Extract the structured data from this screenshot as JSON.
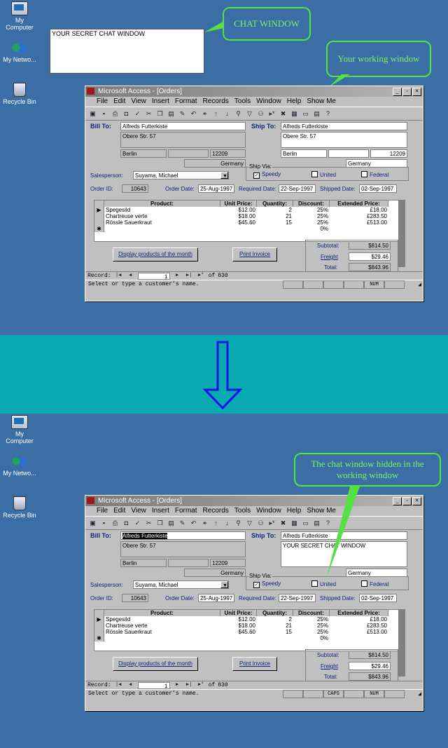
{
  "desktop": {
    "icons": [
      {
        "label": "My Computer"
      },
      {
        "label": "My Netwo..."
      },
      {
        "label": "Recycle Bin"
      }
    ]
  },
  "top": {
    "callout_chat": "CHAT WINDOW",
    "callout_work": "Your working window",
    "chat_text": "YOUR SECRET CHAT WINDOW"
  },
  "bottom": {
    "callout": "The chat window hidden in the working window"
  },
  "window": {
    "title": "Microsoft Access - [Orders]",
    "menu": [
      "File",
      "Edit",
      "View",
      "Insert",
      "Format",
      "Records",
      "Tools",
      "Window",
      "Help",
      "Show Me"
    ]
  },
  "form": {
    "bill_to_label": "Bill To:",
    "ship_to_label": "Ship To:",
    "bill_name": "Alfreds Futterkiste",
    "bill_address": "Obere Str. 57",
    "bill_city": "Berlin",
    "bill_postal": "12209",
    "bill_country": "Germany",
    "ship_name": "Alfreds Futterkiste",
    "ship_address": "Obere Str. 57",
    "ship_city": "Berlin",
    "ship_postal": "12209",
    "ship_country": "Germany",
    "salesperson_label": "Salesperson:",
    "salesperson": "Suyama, Michael",
    "ship_via_label": "Ship Via:",
    "ship_via": [
      "Speedy",
      "United",
      "Federal"
    ],
    "order_id_label": "Order ID:",
    "order_id": "10643",
    "order_date_label": "Order Date:",
    "order_date": "25-Aug-1997",
    "required_date_label": "Required Date:",
    "required_date": "22-Sep-1997",
    "shipped_date_label": "Shipped Date:",
    "shipped_date": "02-Sep-1997",
    "columns": [
      "Product:",
      "Unit Price:",
      "Quantity:",
      "Discount:",
      "Extended Price:"
    ],
    "rows": [
      [
        "Spegesild",
        "$12.00",
        "2",
        "25%",
        "£18.00"
      ],
      [
        "Chartreuse verte",
        "$18.00",
        "21",
        "25%",
        "£283.50"
      ],
      [
        "Rössle Sauerkraut",
        "$45.60",
        "15",
        "25%",
        "£513.00"
      ]
    ],
    "new_row_discount": "0%",
    "display_btn": "Display products of the month",
    "print_btn": "Print Invoice",
    "subtotal_label": "Subtotal:",
    "subtotal": "$814.50",
    "freight_label": "Freight",
    "freight": "$29.46",
    "total_label": "Total:",
    "total": "$843.96"
  },
  "nav": {
    "record_label": "Record:",
    "current": "1",
    "of": "of",
    "count": "830"
  },
  "status": {
    "text": "Select or type a customer's name.",
    "num": "NUM",
    "caps": "CAPS"
  }
}
